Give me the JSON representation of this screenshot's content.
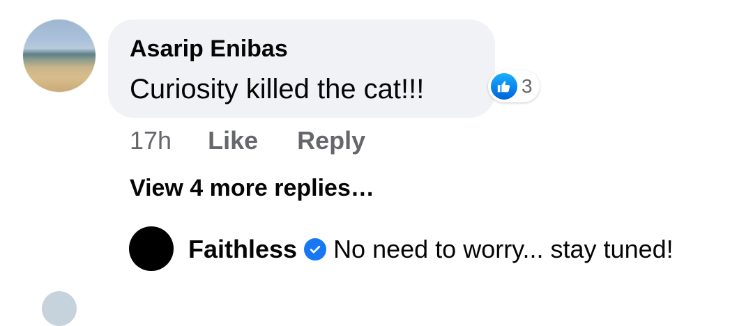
{
  "comment": {
    "author": "Asarip Enibas",
    "text": "Curiosity killed the cat!!!",
    "reaction": {
      "icon": "like-icon",
      "count": "3",
      "color": "#1877f2"
    },
    "timestamp": "17h",
    "actions": {
      "like_label": "Like",
      "reply_label": "Reply"
    }
  },
  "view_more_replies": "View 4 more replies…",
  "reply": {
    "author": "Faithless",
    "verified_icon": "verified-badge-icon",
    "text": "No need to worry... stay tuned!"
  },
  "colors": {
    "bubble_background": "#f0f2f5",
    "secondary_text": "#65676b",
    "primary_text": "#050505",
    "accent_blue": "#1877f2"
  }
}
